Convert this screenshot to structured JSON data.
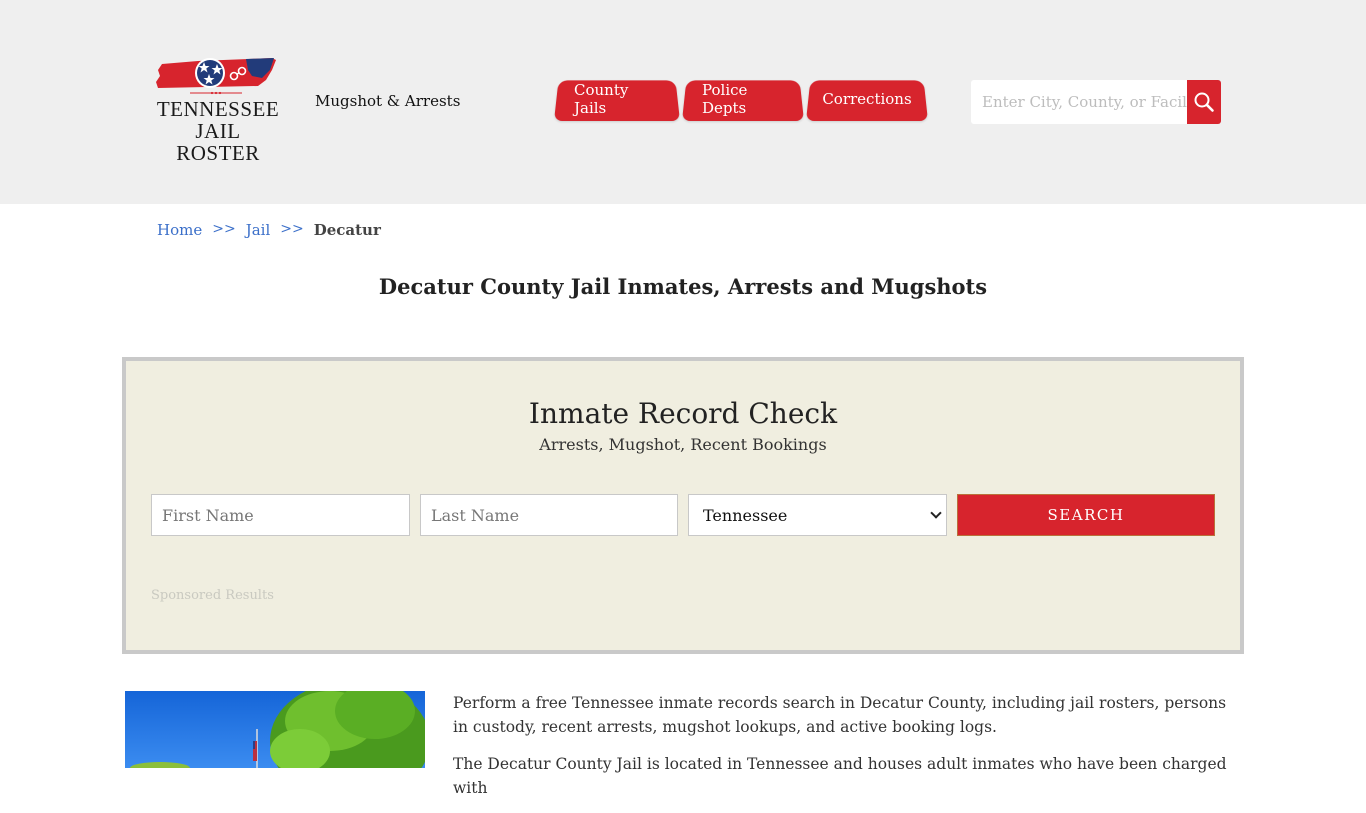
{
  "header": {
    "logo": {
      "line1": "TENNESSEE",
      "line2": "JAIL ROSTER",
      "icon": "tennessee-state-flag-handcuffs-icon"
    },
    "tagline": "Mugshot & Arrests",
    "nav": [
      {
        "label": "County Jails"
      },
      {
        "label": "Police Depts"
      },
      {
        "label": "Corrections"
      }
    ],
    "search": {
      "placeholder": "Enter City, County, or Facility",
      "icon": "magnifier-icon"
    }
  },
  "breadcrumb": {
    "items": [
      {
        "label": "Home"
      },
      {
        "label": "Jail"
      }
    ],
    "separator": ">>",
    "current": "Decatur"
  },
  "page": {
    "title": "Decatur County Jail Inmates, Arrests and Mugshots"
  },
  "record_check": {
    "title": "Inmate Record Check",
    "subtitle": "Arrests, Mugshot, Recent Bookings",
    "first_name_placeholder": "First Name",
    "last_name_placeholder": "Last Name",
    "state_selected": "Tennessee",
    "search_label": "SEARCH",
    "sponsored_label": "Sponsored Results"
  },
  "content": {
    "paragraphs": [
      "Perform a free Tennessee inmate records search in Decatur County, including jail rosters, persons in custody, recent arrests, mugshot lookups, and active booking logs.",
      "The Decatur County Jail is located in Tennessee and houses adult inmates who have been charged with"
    ]
  },
  "colors": {
    "brand_red": "#d7242d",
    "header_bg": "#efefef",
    "panel_bg": "#f0eee0",
    "link_blue": "#3b6fc9"
  }
}
